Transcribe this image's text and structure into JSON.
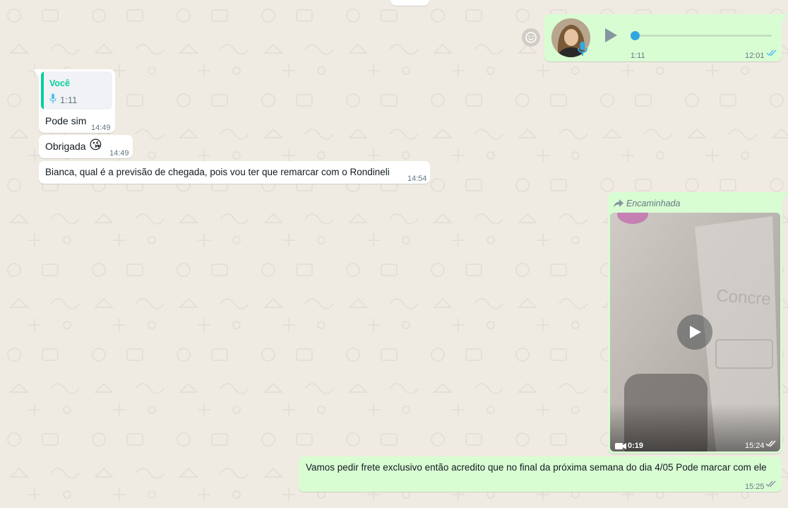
{
  "colors": {
    "incoming_bubble": "#ffffff",
    "outgoing_bubble": "#d9fdd3",
    "chat_background": "#efeae2",
    "accent": "#06cf9c",
    "read_ticks": "#53bdeb",
    "mic_blue": "#35a8e0"
  },
  "audio_message": {
    "duration": "1:11",
    "time": "12:01",
    "progress": 0,
    "icons": [
      "smiley-icon",
      "play-icon",
      "mic-icon",
      "double-check-icon"
    ]
  },
  "messages": [
    {
      "quote_author": "Você",
      "quote_duration": "1:11",
      "text": "Pode sim",
      "time": "14:49"
    },
    {
      "text": "Obrigada",
      "emoji": "😘",
      "time": "14:49"
    },
    {
      "text": "Bianca, qual é a previsão de chegada, pois vou ter que remarcar com o Rondineli",
      "time": "14:54"
    }
  ],
  "video_message": {
    "forwarded_label": "Encaminhada",
    "duration": "0:19",
    "time": "15:24"
  },
  "last_message": {
    "text": "Vamos pedir frete exclusivo então acredito que no final da próxima semana do dia 4/05 Pode marcar com ele",
    "time": "15:25"
  }
}
